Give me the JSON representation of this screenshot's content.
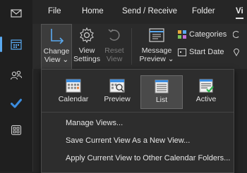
{
  "nav": {
    "items": [
      {
        "name": "mail-icon"
      },
      {
        "name": "calendar-icon"
      },
      {
        "name": "people-icon"
      },
      {
        "name": "tasks-icon"
      },
      {
        "name": "apps-icon"
      }
    ],
    "accent": "#5aa9f0"
  },
  "menubar": {
    "items": [
      "File",
      "Home",
      "Send / Receive",
      "Folder",
      "Vi"
    ]
  },
  "ribbon": {
    "change_view": [
      "Change",
      "View"
    ],
    "view_settings": [
      "View",
      "Settings"
    ],
    "reset_view": [
      "Reset",
      "View"
    ],
    "message_preview": [
      "Message",
      "Preview"
    ],
    "categories": "Categories",
    "start_date": "Start Date"
  },
  "dropdown": {
    "views": [
      {
        "label": "Calendar",
        "icon": "calendar-view-icon"
      },
      {
        "label": "Preview",
        "icon": "preview-view-icon"
      },
      {
        "label": "List",
        "icon": "list-view-icon",
        "selected": true
      },
      {
        "label": "Active",
        "icon": "active-view-icon"
      }
    ],
    "items": [
      "Manage Views...",
      "Save Current View As a New View...",
      "Apply Current View to Other Calendar Folders..."
    ]
  },
  "colors": {
    "background": "#242424",
    "ribbon": "#2b2b2b",
    "dropdown": "#2d2d2d",
    "text": "#e6e6e6"
  }
}
